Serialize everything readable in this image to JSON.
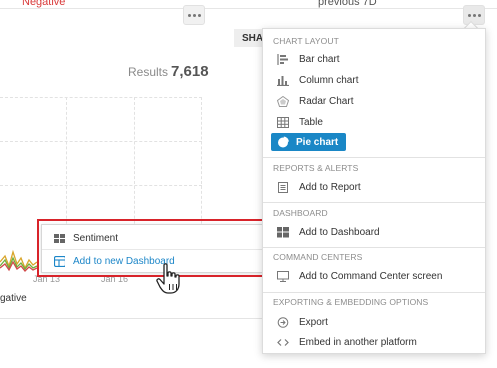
{
  "top": {
    "negative": "Negative",
    "previous": "previous 7D"
  },
  "share_tab": "SHA",
  "results": {
    "label": "Results",
    "value": "7,618"
  },
  "chart": {
    "x_labels": [
      "Jan 13",
      "Jan 16"
    ],
    "legend_negative": "gative"
  },
  "popup": {
    "items": [
      {
        "label": "Sentiment",
        "icon": "grid-icon"
      },
      {
        "label": "Add to new Dashboard",
        "icon": "dashboard-add-icon"
      }
    ]
  },
  "menu": {
    "sections": {
      "layout": "CHART LAYOUT",
      "reports": "REPORTS & ALERTS",
      "dashboard": "DASHBOARD",
      "command": "COMMAND CENTERS",
      "export": "EXPORTING & EMBEDDING OPTIONS"
    },
    "items": {
      "bar": "Bar chart",
      "column": "Column chart",
      "radar": "Radar Chart",
      "table": "Table",
      "pie": "Pie chart",
      "report": "Add to Report",
      "dashboard": "Add to Dashboard",
      "command": "Add to Command Center screen",
      "export": "Export",
      "embed": "Embed in another platform"
    }
  },
  "colors": {
    "accent": "#1a87c6",
    "highlight": "#d8232a",
    "negative": "#d93a3a"
  }
}
